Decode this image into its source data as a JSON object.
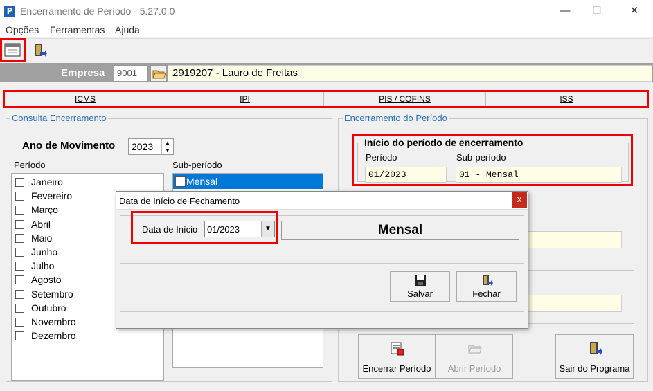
{
  "window": {
    "app_icon": "P",
    "title": "Encerramento de Período - 5.27.0.0",
    "minimize": "—",
    "maximize": "☐",
    "close": "✕"
  },
  "menu": [
    "Opções",
    "Ferramentas",
    "Ajuda"
  ],
  "empresa": {
    "label": "Empresa",
    "code": "9001",
    "name": "2919207 - Lauro de Freitas"
  },
  "tabs": [
    "ICMS",
    "IPI",
    "PIS / COFINS",
    "ISS"
  ],
  "consulta": {
    "title": "Consulta Encerramento",
    "ano_label": "Ano de Movimento",
    "ano_value": "2023",
    "periodo_label": "Período",
    "subperiodo_label": "Sub-período",
    "subperiodo_items": [
      "Mensal"
    ],
    "months": [
      "Janeiro",
      "Fevereiro",
      "Março",
      "Abril",
      "Maio",
      "Junho",
      "Julho",
      "Agosto",
      "Setembro",
      "Outubro",
      "Novembro",
      "Dezembro"
    ]
  },
  "encerramento": {
    "title": "Encerramento do Período",
    "inicio_title": "Início do período de encerramento",
    "periodo_label": "Período",
    "periodo_value": "01/2023",
    "subperiodo_label": "Sub-período",
    "subperiodo_value": "01 - Mensal"
  },
  "buttons": {
    "encerrar": "Encerrar Período",
    "abrir": "Abrir Período",
    "sair": "Sair do Programa"
  },
  "dialog": {
    "title": "Data de Início de Fechamento",
    "close": "x",
    "data_label": "Data de Início",
    "data_value": "01/2023",
    "mensal": "Mensal",
    "salvar": "Salvar",
    "fechar": "Fechar"
  },
  "colors": {
    "highlight_border": "#e00000",
    "group_title": "#2a6fbd",
    "selected_row": "#0078d7",
    "yellow_field": "#fefde6"
  }
}
